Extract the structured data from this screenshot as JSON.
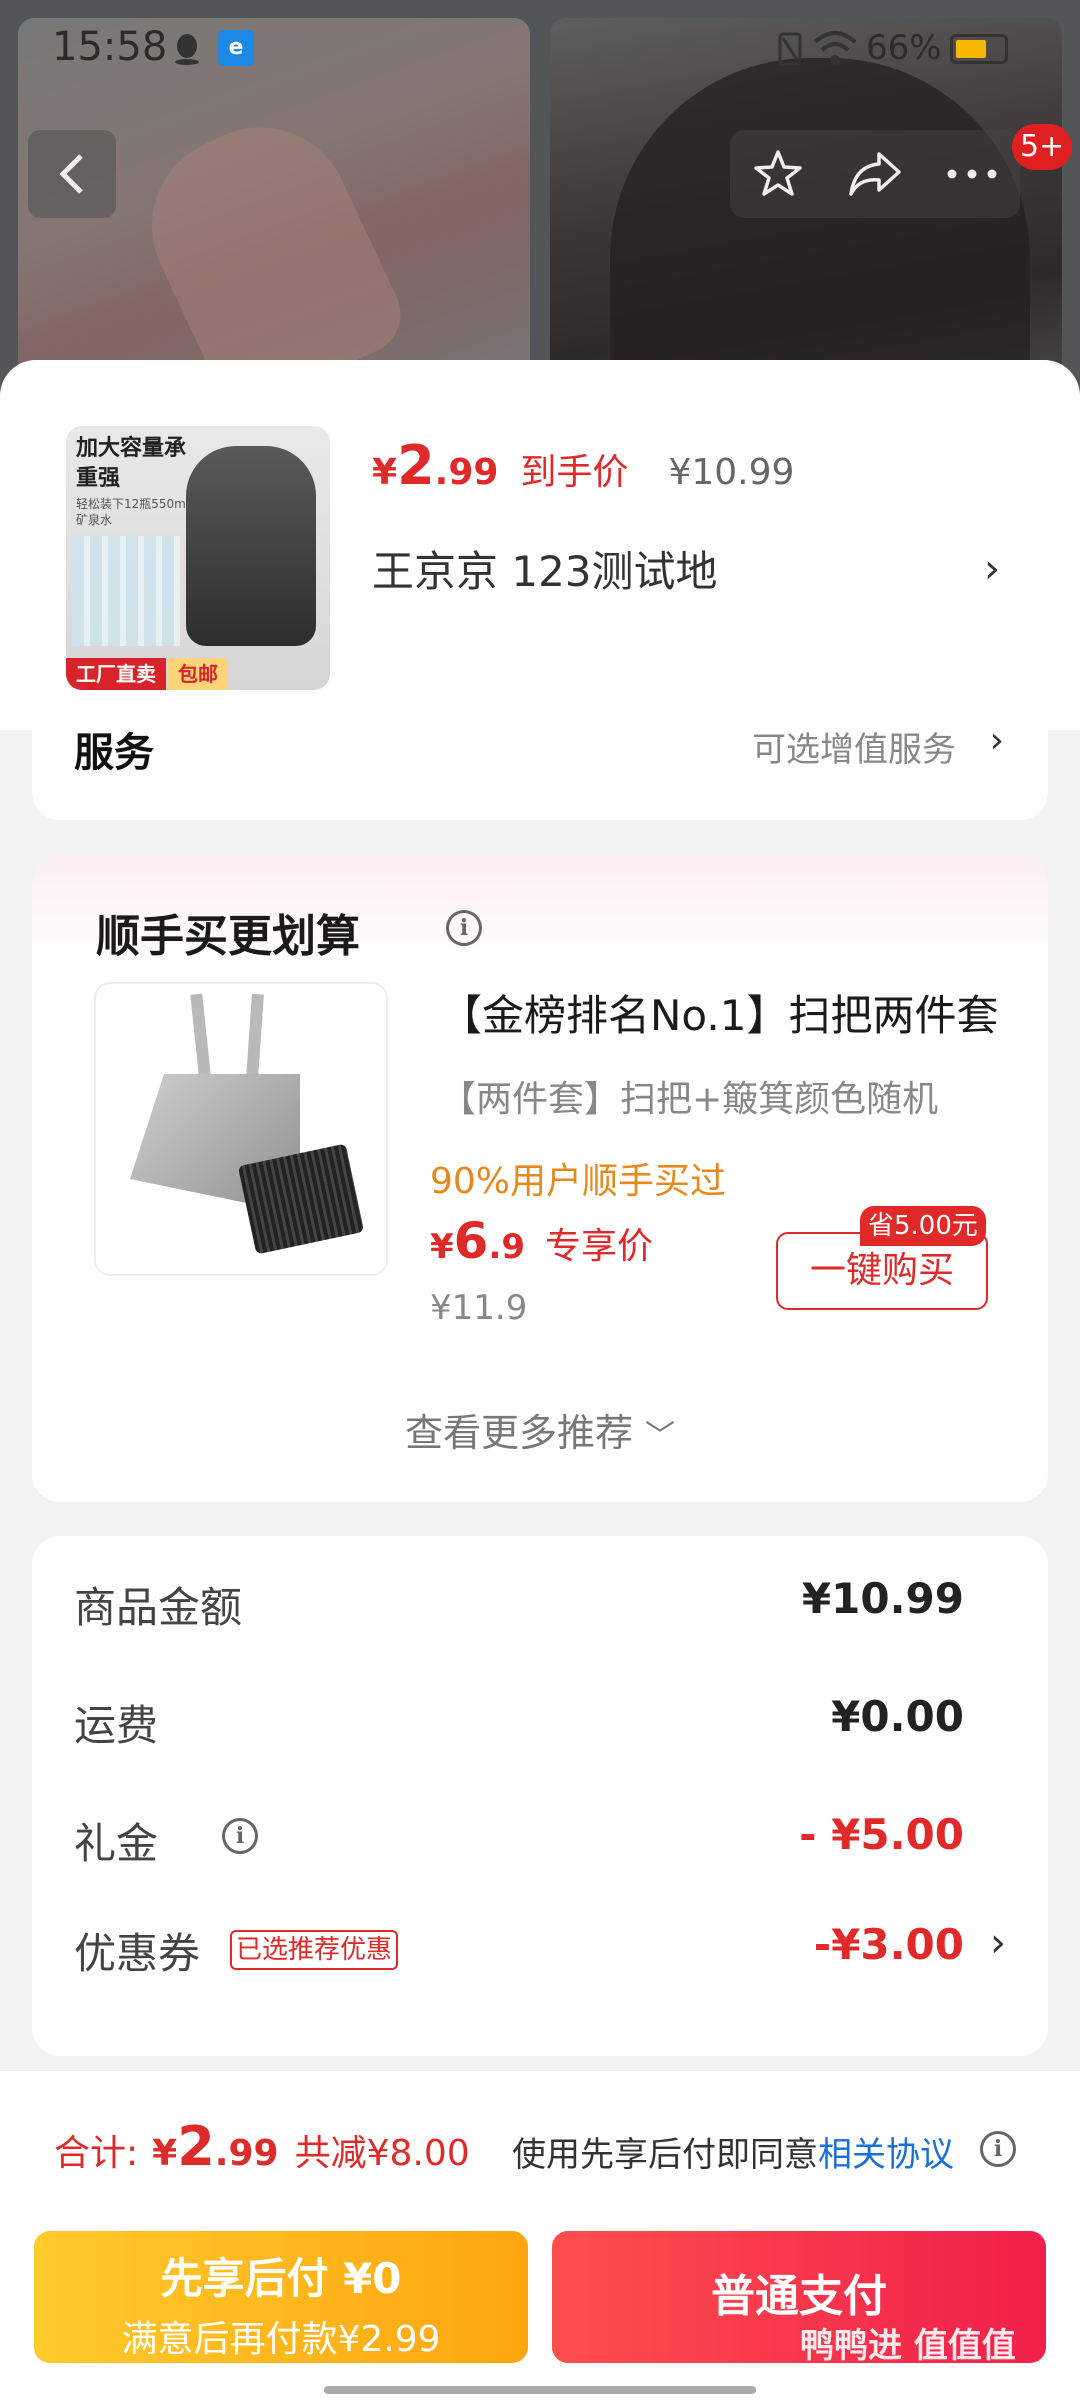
{
  "status_bar": {
    "time": "15:58",
    "battery": "66%"
  },
  "nav": {
    "badge": "5+"
  },
  "product": {
    "thumb_text_1": "加大容量承重强",
    "thumb_text_2": "轻松装下12瓶550ml矿泉水",
    "thumb_tag_1": "工厂直卖",
    "thumb_tag_2": "包邮",
    "price_symbol": "¥",
    "price_int": "2",
    "price_dec": ".99",
    "price_label": "到手价",
    "original_price": "¥10.99",
    "address": "王京京  123测试地"
  },
  "service": {
    "title": "服务",
    "value": "可选增值服务"
  },
  "recommend": {
    "title": "顺手买更划算",
    "name": "【金榜排名No.1】扫把两件套",
    "subtitle": "【两件套】扫把+簸箕颜色随机",
    "percent_text": "90%用户顺手买过",
    "price_symbol": "¥",
    "price_int": "6",
    "price_dec": ".9",
    "price_label": "专享价",
    "original_price": "¥11.9",
    "save_badge": "省5.00元",
    "buy_label": "一键购买",
    "more_label": "查看更多推荐"
  },
  "summary": {
    "rows": [
      {
        "label": "商品金额",
        "value": "¥10.99"
      },
      {
        "label": "运费",
        "value": "¥0.00"
      },
      {
        "label": "礼金",
        "value": "- ¥5.00"
      },
      {
        "label": "优惠券",
        "tag": "已选推荐优惠",
        "value": "-¥3.00"
      }
    ]
  },
  "bottom": {
    "total_label": "合计:",
    "total_symbol": "¥",
    "total_int": "2",
    "total_dec": ".99",
    "discount": "共减¥8.00",
    "agree_text": "使用先享后付即同意",
    "agree_link": "相关协议",
    "pay_later_line1": "先享后付 ¥0",
    "pay_later_line2": "满意后再付款¥2.99",
    "pay_normal": "普通支付"
  },
  "watermark": "鸭鸭进 值值值",
  "colors": {
    "accent_red": "#e02a2a",
    "pay_later_yellow": "#ffb21c",
    "link_blue": "#1a6fd8"
  }
}
